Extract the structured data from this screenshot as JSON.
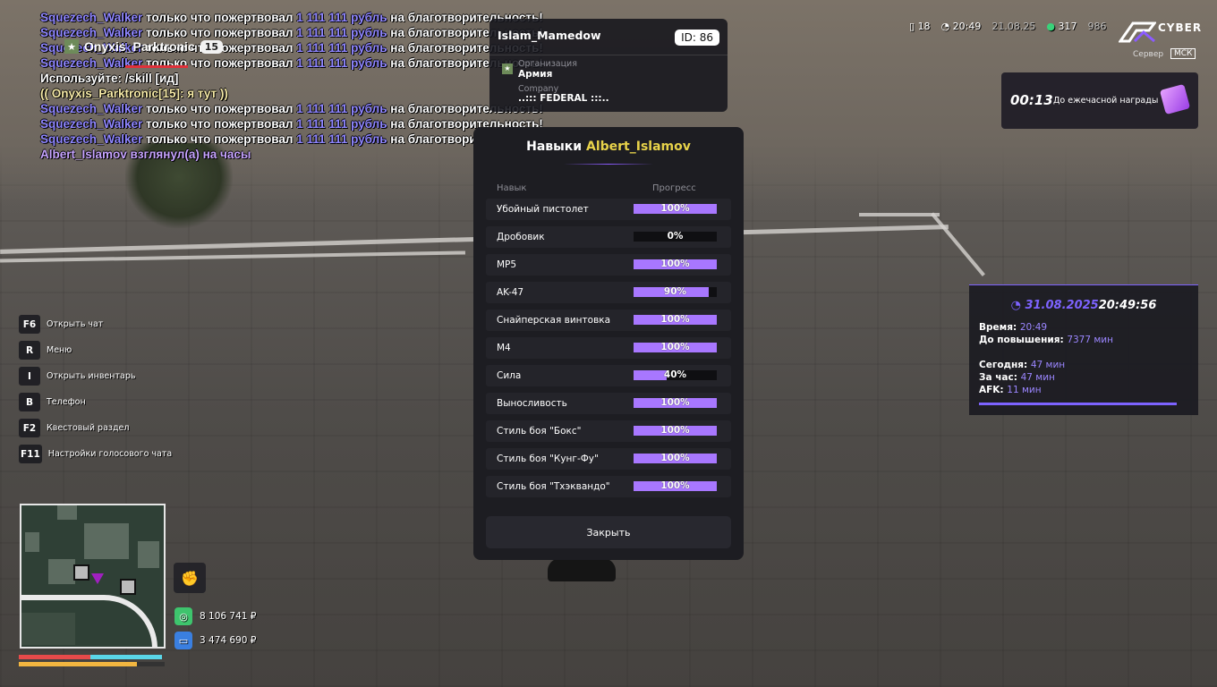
{
  "chat": {
    "lines": [
      {
        "name": "Squezech_Walker",
        "a": " только что пожертвовал ",
        "money": "1 111 111 рубль",
        "b": " на благотворительность!"
      },
      {
        "name": "Squezech_Walker",
        "a": " только что пожертвовал ",
        "money": "1 111 111 рубль",
        "b": " на благотворительность!"
      },
      {
        "name": "Squezech_Walker",
        "a": " только что пожертвовал ",
        "money": "1 111 111 рубль",
        "b": " на благотворительность!"
      },
      {
        "name": "Squezech_Walker",
        "a": " только что пожертвовал ",
        "money": "1 111 111 рубль",
        "b": " на благотворительность!"
      }
    ],
    "usage": "Используйте: /skill [ид]",
    "reply": "(( Onyxis_Parktronic[15]: я тут ))",
    "lines2": [
      {
        "name": "Squezech_Walker",
        "a": " только что пожертвовал ",
        "money": "1 111 111 рубль",
        "b": " на благотворительность!"
      },
      {
        "name": "Squezech_Walker",
        "a": " только что пожертвовал ",
        "money": "1 111 111 рубль",
        "b": " на благотворительность!"
      },
      {
        "name": "Squezech_Walker",
        "a": " только что пожертвовал ",
        "money": "1 111 111 рубль",
        "b": " на благотворительность!"
      }
    ],
    "action": "Albert_Islamov взглянул(а) на часы"
  },
  "nametag": {
    "name": "Onyxis_Parktronic",
    "id": "15",
    "star": "★"
  },
  "topcard": {
    "name": "Islam_Mamedow",
    "id_label": "ID: 86",
    "org_label": "Организация",
    "org_value": "Армия",
    "company_label": "Company",
    "company_value": "..::: FEDERAL :::.."
  },
  "status": {
    "players": "18",
    "clock": "20:49",
    "dim_time": "21.08.25",
    "online": "317",
    "fps": "986"
  },
  "brand": {
    "name": "CYBER",
    "server_label": "Сервер",
    "server_value": "МСК"
  },
  "reward": {
    "timer": "00:13",
    "text": "До ежечасной награды"
  },
  "time_panel": {
    "date": "31.08.2025",
    "time": "20:49:56",
    "rows": [
      {
        "label": "Время:",
        "value": "20:49"
      },
      {
        "label": "До повышения:",
        "value": "7377 мин"
      },
      {
        "label": "Сегодня:",
        "value": "47 мин"
      },
      {
        "label": "За час:",
        "value": "47 мин"
      },
      {
        "label": "AFK:",
        "value": "11 мин"
      }
    ]
  },
  "hotkeys": [
    {
      "key": "F6",
      "label": "Открыть чат"
    },
    {
      "key": "R",
      "label": "Меню"
    },
    {
      "key": "I",
      "label": "Открыть инвентарь"
    },
    {
      "key": "B",
      "label": "Телефон"
    },
    {
      "key": "F2",
      "label": "Квестовый раздел"
    },
    {
      "key": "F11",
      "label": "Настройки голосового чата"
    }
  ],
  "money": {
    "cash": "8 106 741 ₽",
    "bank": "3 474 690 ₽"
  },
  "skills": {
    "title_prefix": "Навыки",
    "player": "Albert_Islamov",
    "col_skill": "Навык",
    "col_progress": "Прогресс",
    "items": [
      {
        "name": "Убойный пистолет",
        "label": "100%",
        "value": 100
      },
      {
        "name": "Дробовик",
        "label": "0%",
        "value": 0
      },
      {
        "name": "MP5",
        "label": "100%",
        "value": 100
      },
      {
        "name": "AK-47",
        "label": "90%",
        "value": 90
      },
      {
        "name": "Снайперская винтовка",
        "label": "100%",
        "value": 100
      },
      {
        "name": "M4",
        "label": "100%",
        "value": 100
      },
      {
        "name": "Сила",
        "label": "40%",
        "value": 40
      },
      {
        "name": "Выносливость",
        "label": "100%",
        "value": 100
      },
      {
        "name": "Стиль боя \"Бокс\"",
        "label": "100%",
        "value": 100
      },
      {
        "name": "Стиль боя \"Кунг-Фу\"",
        "label": "100%",
        "value": 100
      },
      {
        "name": "Стиль боя \"Тхэквандо\"",
        "label": "100%",
        "value": 100
      }
    ],
    "close": "Закрыть",
    "accent": "#a877ff"
  }
}
